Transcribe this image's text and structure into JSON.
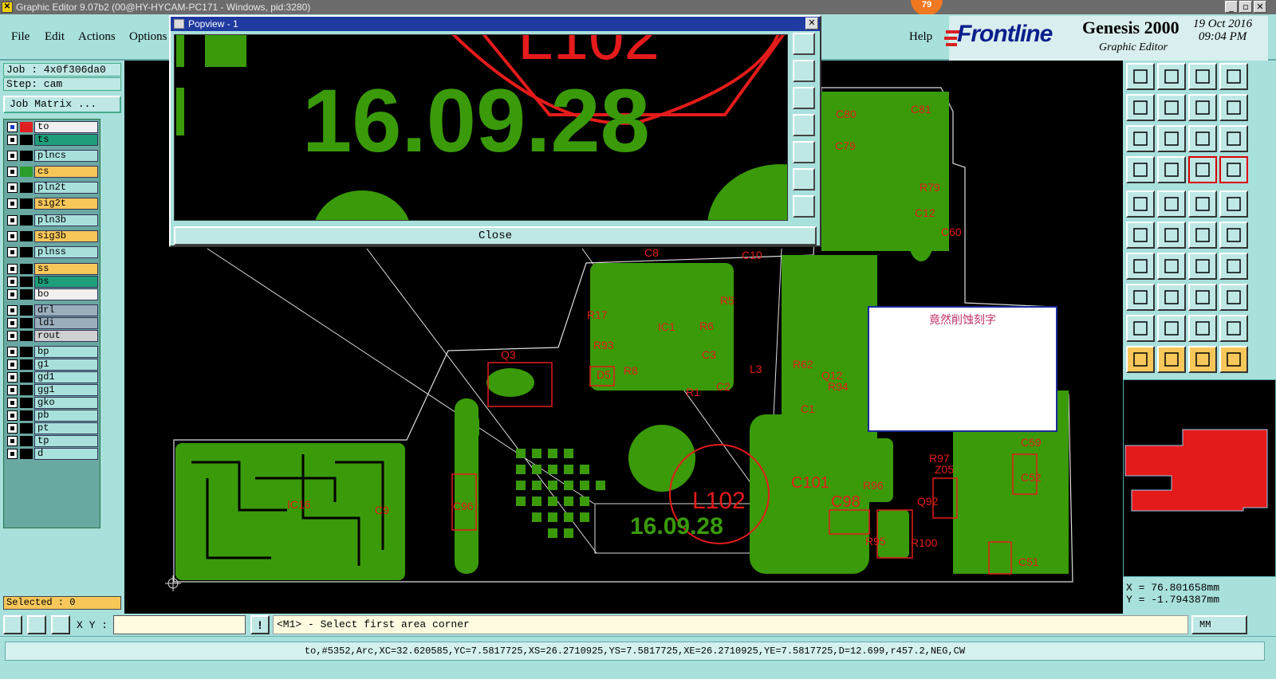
{
  "window": {
    "title": "Graphic Editor 9.07b2 (00@HY-HYCAM-PC171 - Windows, pid:3280)",
    "badge": "79",
    "buttons": [
      "_",
      "▫",
      "✕"
    ]
  },
  "menu": {
    "items": [
      "File",
      "Edit",
      "Actions",
      "Options"
    ],
    "help": "Help"
  },
  "brand": {
    "logo": "Frontline",
    "product": "Genesis 2000",
    "subtitle": "Graphic Editor",
    "date": "19 Oct 2016",
    "time": "09:04 PM"
  },
  "left_panel": {
    "job": "Job : 4x0f306da0",
    "step": "Step: cam",
    "job_matrix": "Job Matrix ...",
    "selected": "Selected : 0",
    "layers": [
      {
        "name": "to",
        "color": "#f0f0f0",
        "swatch": "#e02020",
        "active": true
      },
      {
        "name": "ts",
        "color": "#1e9e7a",
        "swatch": "#000000"
      },
      {
        "name": "plncs",
        "color": "#a8e0dc",
        "swatch": "#000000"
      },
      {
        "name": "cs",
        "color": "#f7c75a",
        "swatch": "#2a9d2a"
      },
      {
        "name": "pln2t",
        "color": "#a8e0dc",
        "swatch": "#000000"
      },
      {
        "name": "sig2t",
        "color": "#f7c75a",
        "swatch": "#000000"
      },
      {
        "name": "pln3b",
        "color": "#a8e0dc",
        "swatch": "#000000"
      },
      {
        "name": "sig3b",
        "color": "#f7c75a",
        "swatch": "#000000"
      },
      {
        "name": "plnss",
        "color": "#a8e0dc",
        "swatch": "#000000"
      },
      {
        "name": "ss",
        "color": "#f7c75a",
        "swatch": "#000000"
      },
      {
        "name": "bs",
        "color": "#1e9e7a",
        "swatch": "#000000"
      },
      {
        "name": "bo",
        "color": "#f0f0f0",
        "swatch": "#000000"
      },
      {
        "name": "drl",
        "color": "#9aaebc",
        "swatch": "#000000"
      },
      {
        "name": "ldi",
        "color": "#9aaebc",
        "swatch": "#000000"
      },
      {
        "name": "rout",
        "color": "#d0d0d0",
        "swatch": "#000000"
      },
      {
        "name": "bp",
        "color": "#a8e0dc",
        "swatch": "#000000"
      },
      {
        "name": "g1",
        "color": "#a8e0dc",
        "swatch": "#000000"
      },
      {
        "name": "gd1",
        "color": "#a8e0dc",
        "swatch": "#000000"
      },
      {
        "name": "gg1",
        "color": "#a8e0dc",
        "swatch": "#000000"
      },
      {
        "name": "gko",
        "color": "#a8e0dc",
        "swatch": "#000000"
      },
      {
        "name": "pb",
        "color": "#a8e0dc",
        "swatch": "#000000"
      },
      {
        "name": "pt",
        "color": "#a8e0dc",
        "swatch": "#000000"
      },
      {
        "name": "tp",
        "color": "#a8e0dc",
        "swatch": "#000000"
      },
      {
        "name": "d",
        "color": "#a8e0dc",
        "swatch": "#000000"
      }
    ]
  },
  "popview": {
    "title": "Popview - 1",
    "close_label": "Close",
    "big_text": "16.09.28",
    "ref": "L102"
  },
  "board": {
    "labels": [
      "Q3",
      "C8",
      "C10",
      "C80",
      "C81",
      "C79",
      "R79",
      "C60",
      "C12",
      "R5",
      "R6",
      "IC1",
      "R93",
      "D5",
      "R1",
      "C2",
      "L3",
      "R62",
      "Q12",
      "R94",
      "C1",
      "L102",
      "C101",
      "C98",
      "16.09.28",
      "R96",
      "R97",
      "Z05",
      "Q92",
      "R95",
      "R100",
      "C59",
      "C52",
      "C51",
      "C96",
      "IC16",
      "C9",
      "R17",
      "R8",
      "C3"
    ]
  },
  "note": {
    "text": "竟然削蚀刻字"
  },
  "coords": {
    "x": "X = 76.801658mm",
    "y": "Y = -1.794387mm"
  },
  "command": {
    "xy_label": "X Y :",
    "xy_value": "",
    "prompt": "<M1> - Select first area corner",
    "units": "MM"
  },
  "status": {
    "text": "to,#5352,Arc,XC=32.620585,YC=7.5817725,XS=26.2710925,YS=7.5817725,XE=26.2710925,YE=7.5817725,D=12.699,r457.2,NEG,CW"
  },
  "colors": {
    "copper": "#3a9a0a",
    "silk": "#e51b1b",
    "panel": "#a8e0dc",
    "highlight": "#f7c75a"
  }
}
